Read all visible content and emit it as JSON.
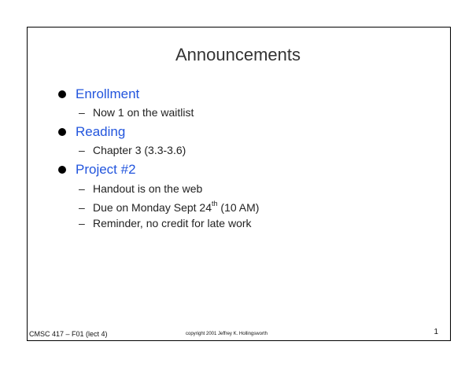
{
  "slide": {
    "title": "Announcements",
    "bullets": [
      {
        "label": "Enrollment",
        "subitems": [
          "Now 1 on the waitlist"
        ]
      },
      {
        "label": "Reading",
        "subitems": [
          "Chapter 3 (3.3-3.6)"
        ]
      },
      {
        "label": "Project #2",
        "subitems": [
          "Handout is on the web",
          "Due on Monday Sept 24",
          "Reminder, no credit for late work"
        ]
      }
    ],
    "due_superscript": "th",
    "due_suffix": " (10 AM)"
  },
  "footer": {
    "left": "CMSC 417 – F01  (lect 4)",
    "center": "copyright 2001 Jeffrey K. Hollingsworth",
    "page_number": "1"
  },
  "colors": {
    "bullet_text": "#2255dd",
    "frame": "#000000"
  }
}
